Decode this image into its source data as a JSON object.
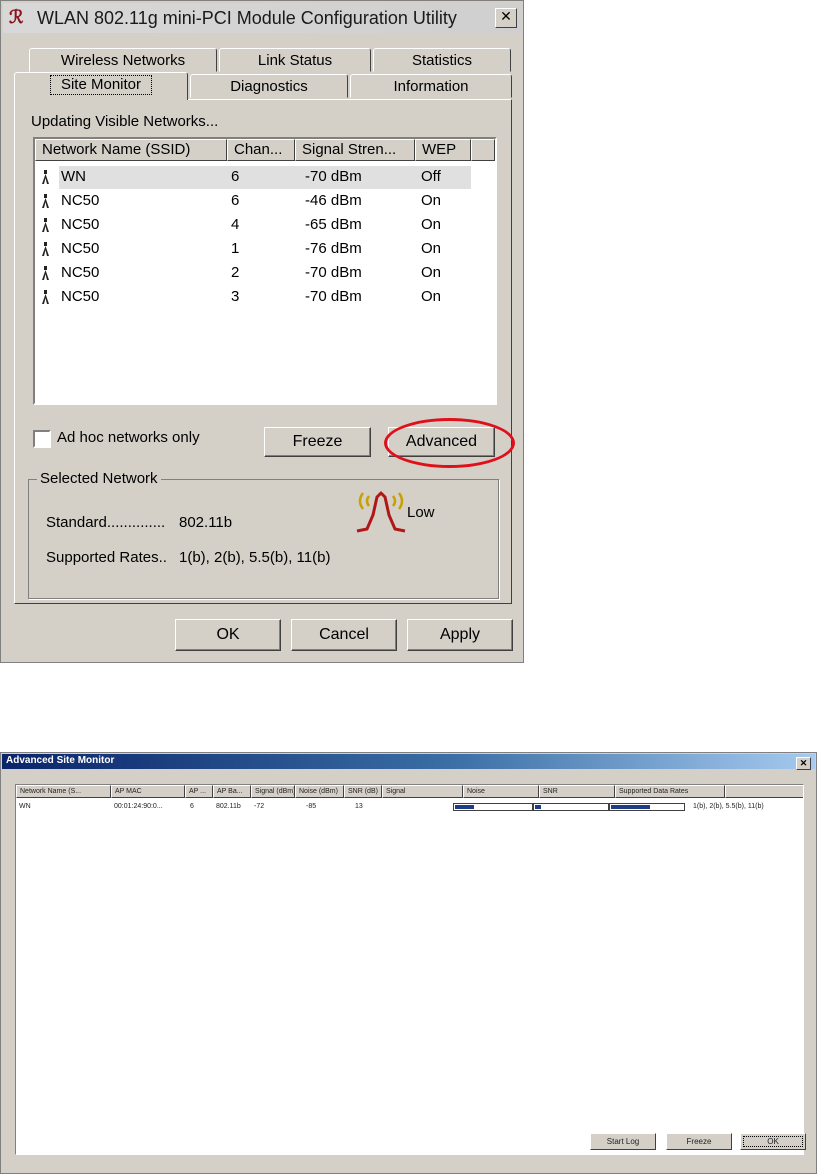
{
  "main_dialog": {
    "title": "WLAN 802.11g mini-PCI Module Configuration Utility",
    "close_glyph": "✕",
    "tabs_back": [
      "Wireless Networks",
      "Link Status",
      "Statistics"
    ],
    "tabs_front": [
      "Site Monitor",
      "Diagnostics",
      "Information"
    ],
    "active_tab": "Site Monitor",
    "status_label": "Updating Visible Networks...",
    "columns": [
      "Network Name (SSID)",
      "Chan...",
      "Signal Stren...",
      "WEP"
    ],
    "rows": [
      {
        "ssid": "WN",
        "channel": "6",
        "signal": "-70 dBm",
        "wep": "Off",
        "selected": true
      },
      {
        "ssid": "NC50",
        "channel": "6",
        "signal": "-46 dBm",
        "wep": "On"
      },
      {
        "ssid": "NC50",
        "channel": "4",
        "signal": "-65 dBm",
        "wep": "On"
      },
      {
        "ssid": "NC50",
        "channel": "1",
        "signal": "-76 dBm",
        "wep": "On"
      },
      {
        "ssid": "NC50",
        "channel": "2",
        "signal": "-70 dBm",
        "wep": "On"
      },
      {
        "ssid": "NC50",
        "channel": "3",
        "signal": "-70 dBm",
        "wep": "On"
      }
    ],
    "adhoc_label": "Ad hoc networks only",
    "freeze_label": "Freeze",
    "advanced_label": "Advanced",
    "selected_network": {
      "legend": "Selected Network",
      "standard_label": "Standard..............",
      "standard_value": "802.11b",
      "rates_label": "Supported Rates..",
      "rates_value": "1(b), 2(b), 5.5(b), 11(b)",
      "signal_quality": "Low"
    },
    "ok_label": "OK",
    "cancel_label": "Cancel",
    "apply_label": "Apply"
  },
  "advanced_dialog": {
    "title": "Advanced Site Monitor",
    "close_glyph": "✕",
    "columns": [
      "Network Name (S...",
      "AP MAC",
      "AP ...",
      "AP Ba...",
      "Signal (dBm)",
      "Noise (dBm)",
      "SNR (dB)",
      "Signal",
      "Noise",
      "SNR",
      "Supported Data Rates"
    ],
    "row": {
      "name": "WN",
      "ap_mac": "00:01:24:90:0...",
      "channel": "6",
      "band": "802.11b",
      "signal_dbm": "-72",
      "noise_dbm": "-85",
      "snr_db": "13",
      "signal_level": 0.25,
      "noise_level": 0.08,
      "snr_level": 0.55,
      "rates": "1(b), 2(b), 5.5(b), 11(b)"
    },
    "start_log_label": "Start Log",
    "freeze_label": "Freeze",
    "ok_label": "OK"
  }
}
